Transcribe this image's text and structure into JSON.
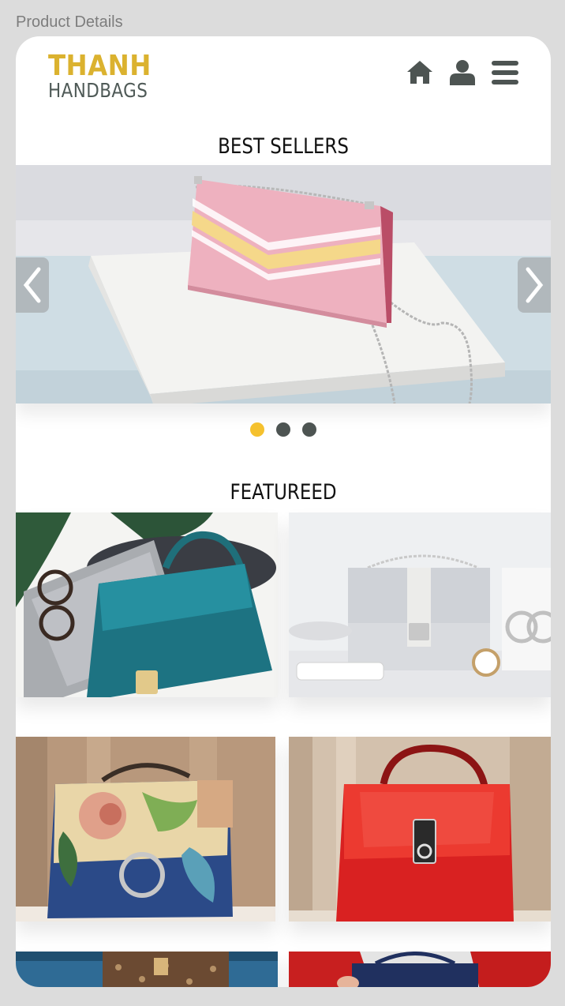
{
  "window": {
    "title": "Product Details"
  },
  "brand": {
    "name_top": "THANH",
    "name_bottom": "HANDBAGS",
    "colors": {
      "gold": "#dbb22f",
      "slate": "#4f5a57"
    }
  },
  "nav": {
    "icons": [
      "home-icon",
      "user-icon",
      "menu-icon"
    ]
  },
  "best_sellers": {
    "title": "BEST SELLERS",
    "slides_count": 3,
    "active_slide": 1,
    "dot_colors": {
      "active": "#f5c12e",
      "inactive": "#4d5452"
    }
  },
  "featured": {
    "title": "FEATUREED",
    "products": [
      {
        "image": "teal-handbag"
      },
      {
        "image": "grey-studded-handbag"
      },
      {
        "image": "floral-handbag"
      },
      {
        "image": "red-handbag"
      },
      {
        "image": "monogram-handbag"
      },
      {
        "image": "navy-handbag"
      }
    ]
  }
}
